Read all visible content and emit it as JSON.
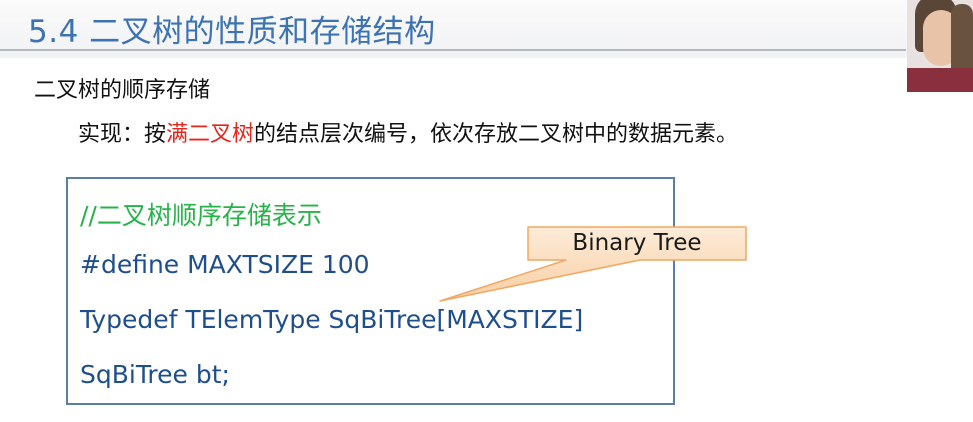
{
  "header": {
    "title": "5.4  二叉树的性质和存储结构"
  },
  "content": {
    "subtitle": "二叉树的顺序存储",
    "description": {
      "prefix": "实现：按",
      "highlight": "满二叉树",
      "suffix": "的结点层次编号，依次存放二叉树中的数据元素。"
    },
    "code": {
      "comment": "//二叉树顺序存储表示",
      "line1": "#define MAXTSIZE 100",
      "line2": "Typedef TElemType SqBiTree[MAXSTIZE]",
      "line3": "SqBiTree bt;"
    },
    "callout": {
      "label": "Binary Tree"
    }
  },
  "colors": {
    "title": "#3e73b3",
    "highlight": "#e8251c",
    "comment": "#27b34a",
    "code": "#1f4e8c",
    "callout_fill": "#fbe2c8",
    "callout_stroke": "#f0a865"
  }
}
